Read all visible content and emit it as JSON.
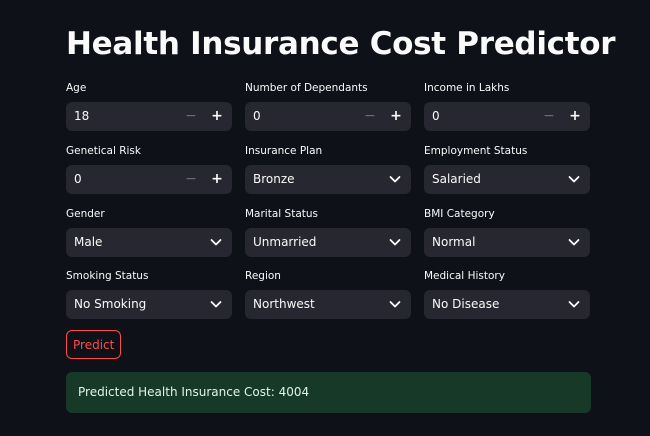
{
  "app": {
    "title": "Health Insurance Cost Predictor"
  },
  "fields": {
    "age": {
      "label": "Age",
      "value": "18",
      "type": "number"
    },
    "dependants": {
      "label": "Number of Dependants",
      "value": "0",
      "type": "number"
    },
    "income": {
      "label": "Income in Lakhs",
      "value": "0",
      "type": "number"
    },
    "genetical_risk": {
      "label": "Genetical Risk",
      "value": "0",
      "type": "number"
    },
    "insurance_plan": {
      "label": "Insurance Plan",
      "value": "Bronze",
      "type": "select"
    },
    "employment_status": {
      "label": "Employment Status",
      "value": "Salaried",
      "type": "select"
    },
    "gender": {
      "label": "Gender",
      "value": "Male",
      "type": "select"
    },
    "marital_status": {
      "label": "Marital Status",
      "value": "Unmarried",
      "type": "select"
    },
    "bmi_category": {
      "label": "BMI Category",
      "value": "Normal",
      "type": "select"
    },
    "smoking_status": {
      "label": "Smoking Status",
      "value": "No Smoking",
      "type": "select"
    },
    "region": {
      "label": "Region",
      "value": "Northwest",
      "type": "select"
    },
    "medical_history": {
      "label": "Medical History",
      "value": "No Disease",
      "type": "select"
    }
  },
  "stepper": {
    "minus": "−",
    "plus": "+"
  },
  "predict_button": {
    "label": "Predict"
  },
  "result": {
    "text": "Predicted Health Insurance Cost: 4004"
  },
  "colors": {
    "background": "#0e1117",
    "input_background": "#262730",
    "accent": "#ff4b4b",
    "success_background": "#173928"
  }
}
